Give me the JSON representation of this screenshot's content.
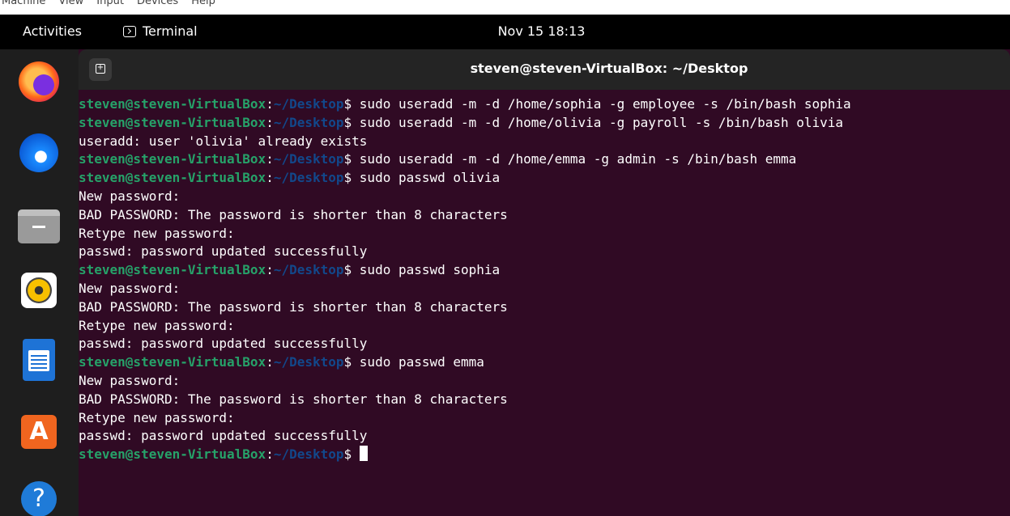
{
  "vbox_menu": [
    "Machine",
    "View",
    "Input",
    "Devices",
    "Help"
  ],
  "topbar": {
    "activities": "Activities",
    "app_name": "Terminal",
    "datetime": "Nov 15  18:13"
  },
  "dock": {
    "apps": [
      "firefox",
      "thunderbird",
      "files",
      "rhythmbox",
      "libreoffice-writer",
      "app-center",
      "help"
    ]
  },
  "window": {
    "title": "steven@steven-VirtualBox: ~/Desktop"
  },
  "terminal": {
    "prompt_user": "steven@steven-VirtualBox",
    "prompt_sep": ":",
    "prompt_path": "~/Desktop",
    "prompt_end": "$ ",
    "lines": [
      {
        "type": "cmd",
        "text": "sudo useradd -m -d /home/sophia -g employee -s /bin/bash sophia"
      },
      {
        "type": "cmd",
        "text": "sudo useradd -m -d /home/olivia -g payroll -s /bin/bash olivia"
      },
      {
        "type": "out",
        "text": "useradd: user 'olivia' already exists"
      },
      {
        "type": "cmd",
        "text": "sudo useradd -m -d /home/emma -g admin -s /bin/bash emma"
      },
      {
        "type": "cmd",
        "text": "sudo passwd olivia"
      },
      {
        "type": "out",
        "text": "New password:"
      },
      {
        "type": "out",
        "text": "BAD PASSWORD: The password is shorter than 8 characters"
      },
      {
        "type": "out",
        "text": "Retype new password:"
      },
      {
        "type": "out",
        "text": "passwd: password updated successfully"
      },
      {
        "type": "cmd",
        "text": "sudo passwd sophia"
      },
      {
        "type": "out",
        "text": "New password:"
      },
      {
        "type": "out",
        "text": "BAD PASSWORD: The password is shorter than 8 characters"
      },
      {
        "type": "out",
        "text": "Retype new password:"
      },
      {
        "type": "out",
        "text": "passwd: password updated successfully"
      },
      {
        "type": "cmd",
        "text": "sudo passwd emma"
      },
      {
        "type": "out",
        "text": "New password:"
      },
      {
        "type": "out",
        "text": "BAD PASSWORD: The password is shorter than 8 characters"
      },
      {
        "type": "out",
        "text": "Retype new password:"
      },
      {
        "type": "out",
        "text": "passwd: password updated successfully"
      },
      {
        "type": "cursor",
        "text": ""
      }
    ]
  },
  "colors": {
    "terminal_bg": "#300a24",
    "prompt_user": "#26a269",
    "prompt_path": "#12488b",
    "text": "#ffffff"
  }
}
